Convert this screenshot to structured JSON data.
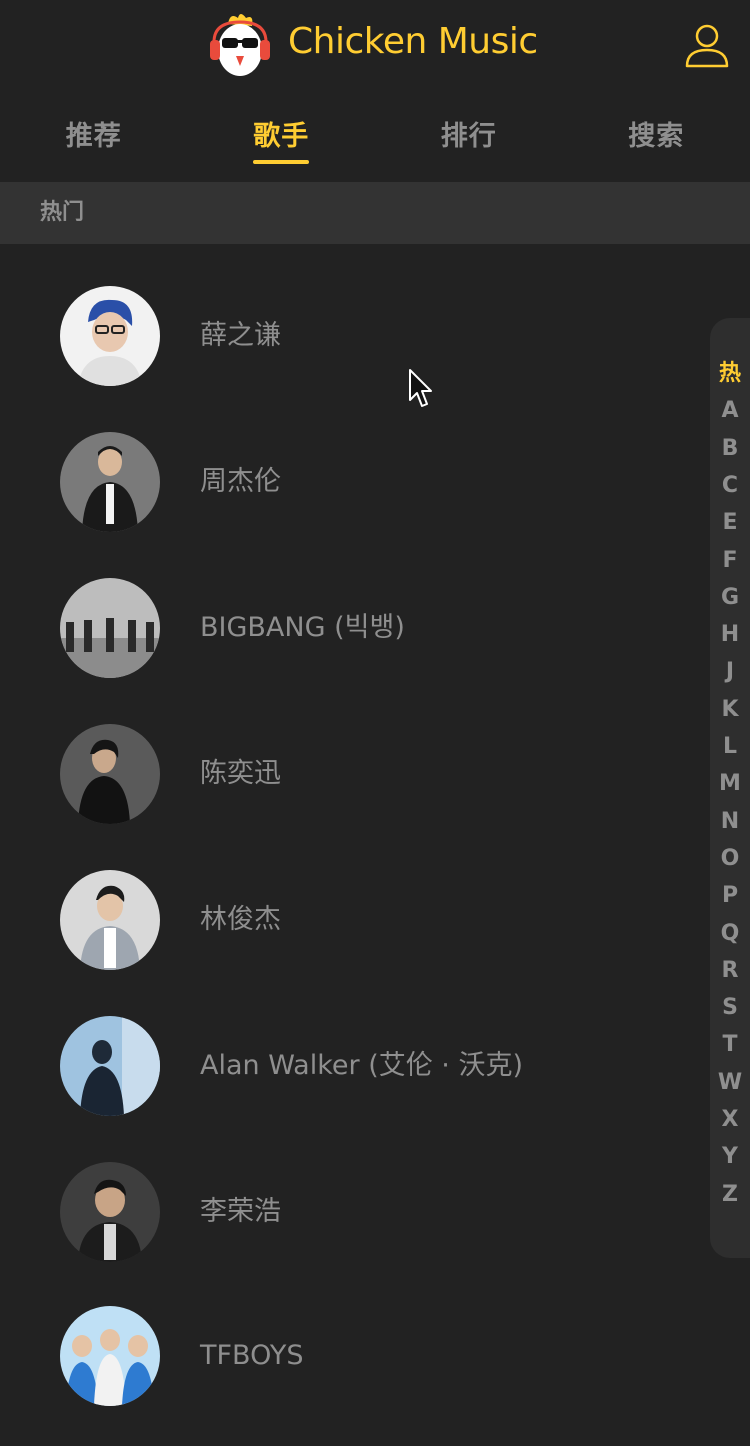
{
  "header": {
    "brand": "Chicken Music",
    "logo_icon": "chicken-logo-icon",
    "user_icon": "user-icon",
    "accent": "#ffcd32"
  },
  "tabs": [
    {
      "label": "推荐",
      "active": false
    },
    {
      "label": "歌手",
      "active": true
    },
    {
      "label": "排行",
      "active": false
    },
    {
      "label": "搜索",
      "active": false
    }
  ],
  "group": {
    "title": "热门"
  },
  "singers": [
    {
      "name": "薛之谦",
      "avatar_bg": "#e8e8e8"
    },
    {
      "name": "周杰伦",
      "avatar_bg": "#6a6a6a"
    },
    {
      "name": "BIGBANG (빅뱅)",
      "avatar_bg": "#9a9a9a"
    },
    {
      "name": "陈奕迅",
      "avatar_bg": "#555555"
    },
    {
      "name": "林俊杰",
      "avatar_bg": "#cfcfcf"
    },
    {
      "name": "Alan Walker (艾伦 · 沃克)",
      "avatar_bg": "#3d6b9a"
    },
    {
      "name": "李荣浩",
      "avatar_bg": "#4a4a4a"
    },
    {
      "name": "TFBOYS",
      "avatar_bg": "#8fc4e8"
    }
  ],
  "index": [
    "热",
    "A",
    "B",
    "C",
    "E",
    "F",
    "G",
    "H",
    "J",
    "K",
    "L",
    "M",
    "N",
    "O",
    "P",
    "Q",
    "R",
    "S",
    "T",
    "W",
    "X",
    "Y",
    "Z"
  ],
  "index_active": "热"
}
